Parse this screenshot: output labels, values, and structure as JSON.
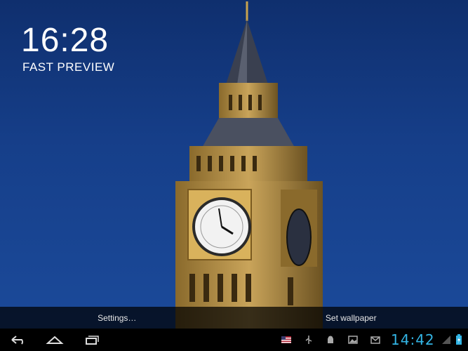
{
  "lockscreen": {
    "time": "16:28",
    "subtitle": "FAST PREVIEW"
  },
  "action_bar": {
    "settings_label": "Settings…",
    "set_wallpaper_label": "Set wallpaper"
  },
  "system_bar": {
    "time": "14:42",
    "accent_color": "#33b5e5",
    "nav_icons": [
      "back-icon",
      "home-icon",
      "recent-apps-icon"
    ],
    "status_icons": [
      "us-flag-icon",
      "usb-icon",
      "android-debug-icon",
      "gallery-icon",
      "gmail-icon",
      "signal-icon",
      "battery-charging-icon"
    ]
  }
}
